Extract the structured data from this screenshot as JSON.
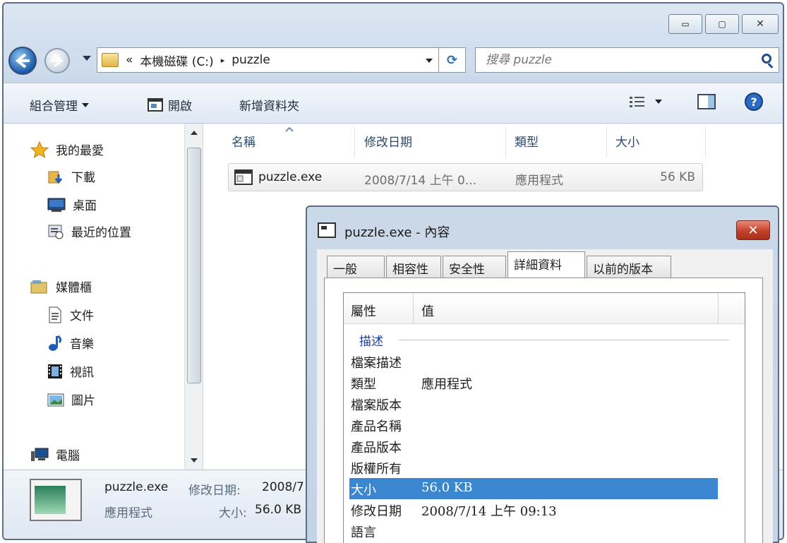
{
  "window_controls": {
    "minimize": "▭",
    "maximize": "▢",
    "close": "✕"
  },
  "address": {
    "overflow": "«",
    "crumb1": "本機磁碟 (C:)",
    "separator": "▸",
    "crumb2": "puzzle",
    "refresh": "⟳"
  },
  "search": {
    "placeholder": "搜尋 puzzle"
  },
  "toolbar": {
    "organize": "組合管理",
    "open": "開啟",
    "new_folder": "新增資料夾"
  },
  "nav": {
    "favorites": "我的最愛",
    "downloads": "下載",
    "desktop": "桌面",
    "recent": "最近的位置",
    "libraries": "媒體櫃",
    "documents": "文件",
    "music": "音樂",
    "videos": "視訊",
    "pictures": "圖片",
    "computer": "電腦"
  },
  "columns": {
    "name": "名稱",
    "modified": "修改日期",
    "type": "類型",
    "size": "大小"
  },
  "file": {
    "name": "puzzle.exe",
    "modified": "2008/7/14 上午 0...",
    "type": "應用程式",
    "size": "56 KB"
  },
  "details": {
    "name": "puzzle.exe",
    "modified_label": "修改日期:",
    "modified_value": "2008/7",
    "type": "應用程式",
    "size_label": "大小:",
    "size_value": "56.0 KB"
  },
  "dialog": {
    "title": "puzzle.exe - 內容",
    "tabs": [
      "一般",
      "相容性",
      "安全性",
      "詳細資料",
      "以前的版本"
    ],
    "col_property": "屬性",
    "col_value": "值",
    "group": "描述",
    "rows": [
      {
        "k": "檔案描述",
        "v": ""
      },
      {
        "k": "類型",
        "v": "應用程式"
      },
      {
        "k": "檔案版本",
        "v": ""
      },
      {
        "k": "產品名稱",
        "v": ""
      },
      {
        "k": "產品版本",
        "v": ""
      },
      {
        "k": "版權所有",
        "v": ""
      },
      {
        "k": "大小",
        "v": "56.0 KB"
      },
      {
        "k": "修改日期",
        "v": "2008/7/14 上午 09:13"
      },
      {
        "k": "語言",
        "v": ""
      }
    ]
  }
}
